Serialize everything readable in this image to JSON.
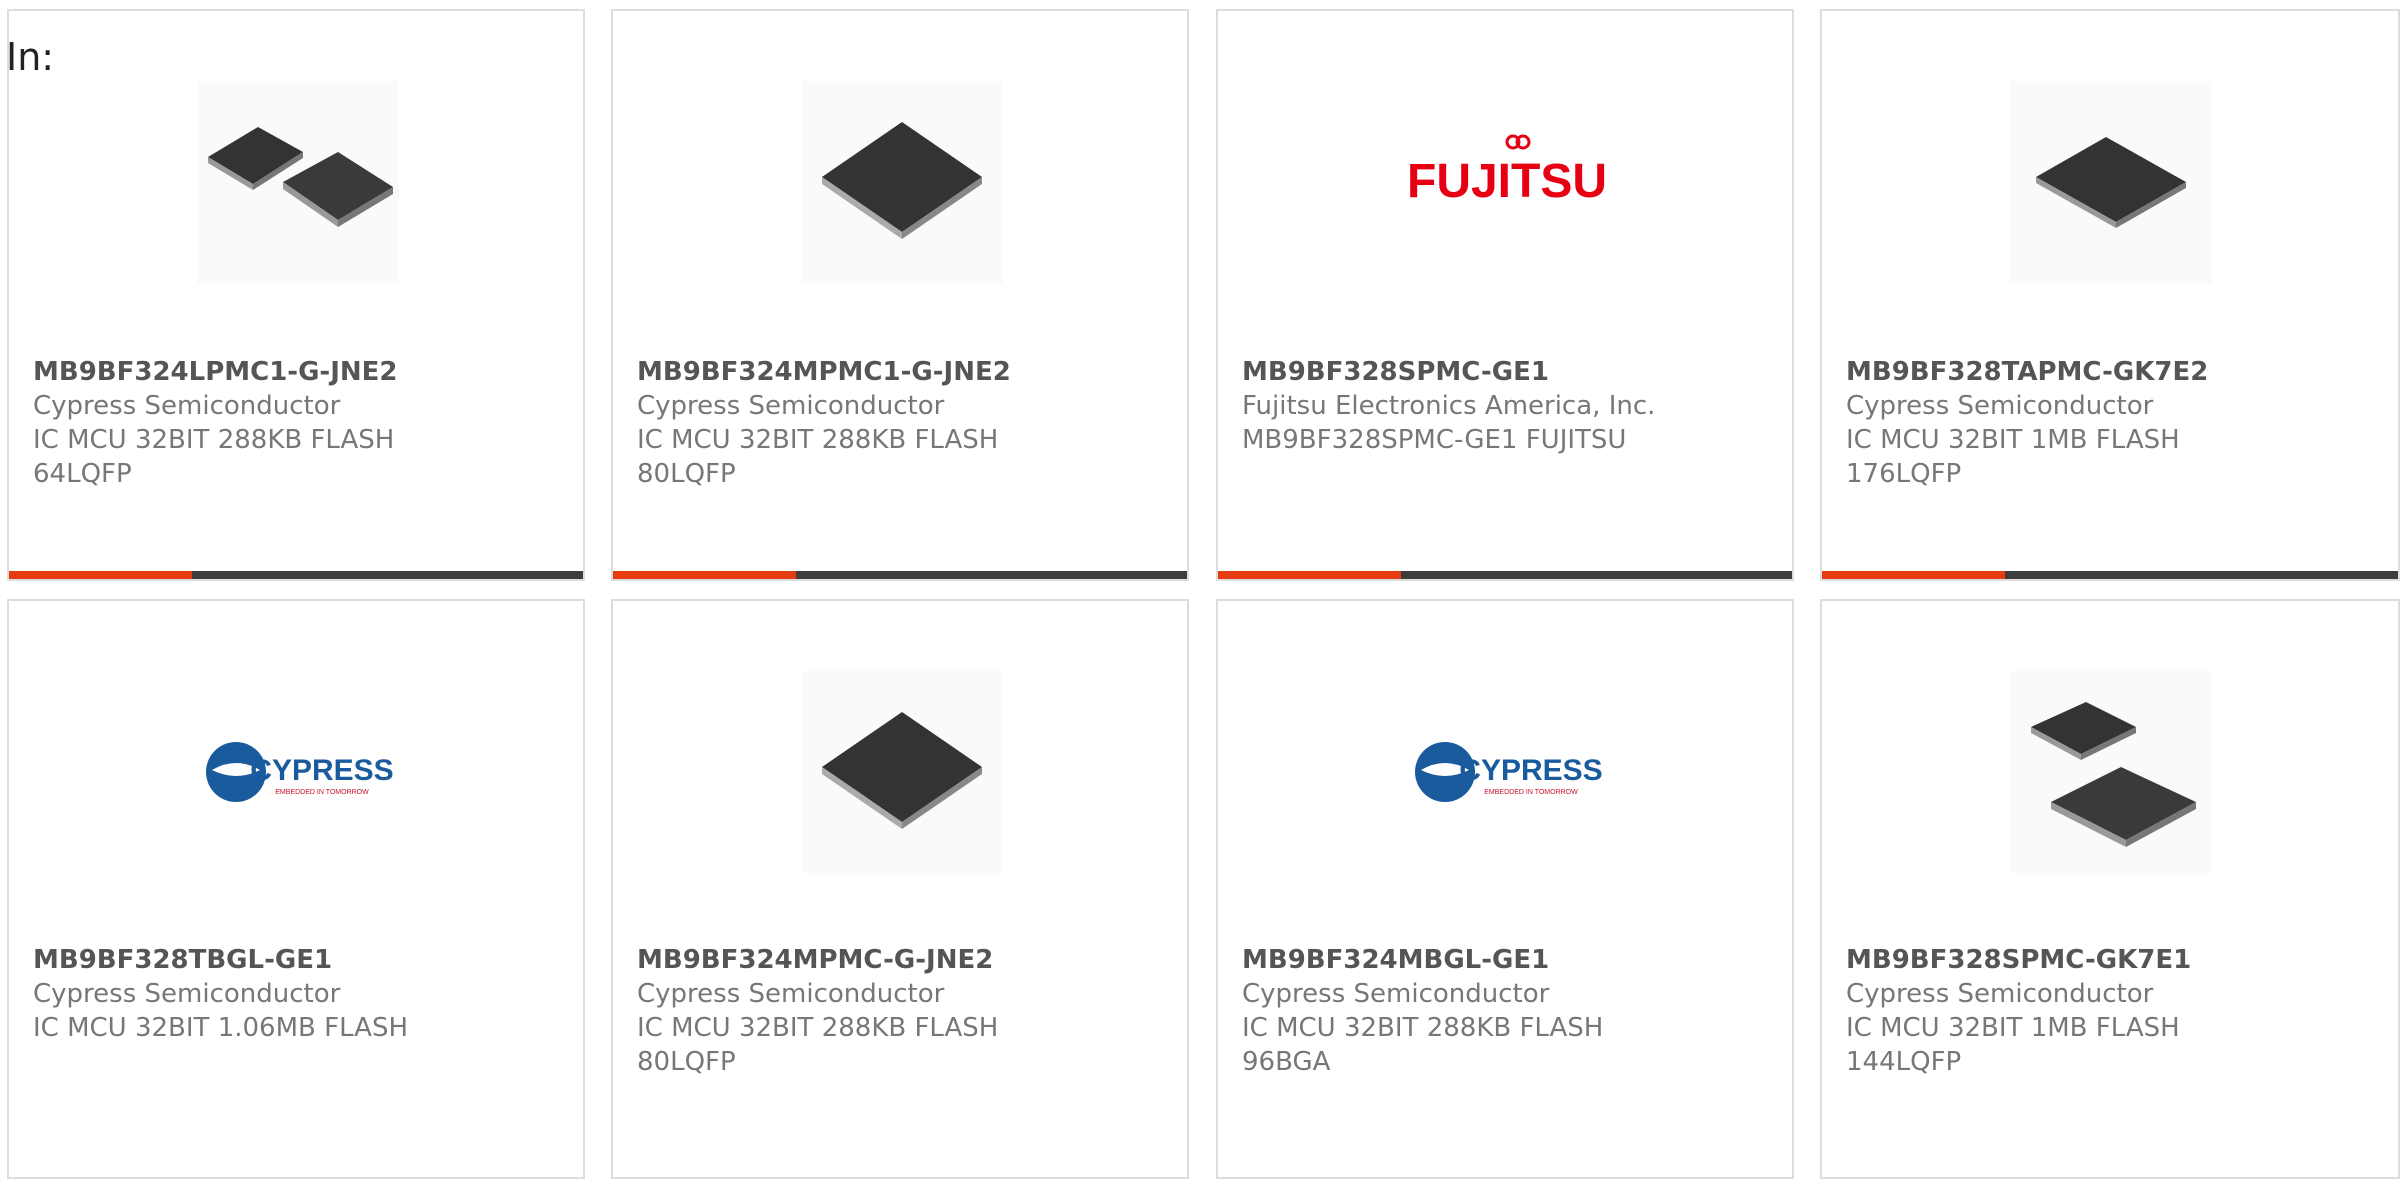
{
  "header": {
    "in_label": "In:"
  },
  "accent_color": "#e53c12",
  "bar_color": "#3d3d3d",
  "products": [
    {
      "part_number": "MB9BF324LPMC1-G-JNE2",
      "manufacturer": "Cypress Semiconductor",
      "desc_line1": "IC MCU 32BIT 288KB FLASH",
      "desc_line2": "64LQFP",
      "image": "two-qfp-chips"
    },
    {
      "part_number": "MB9BF324MPMC1-G-JNE2",
      "manufacturer": "Cypress Semiconductor",
      "desc_line1": "IC MCU 32BIT 288KB FLASH",
      "desc_line2": "80LQFP",
      "image": "qfp-chip"
    },
    {
      "part_number": "MB9BF328SPMC-GE1",
      "manufacturer": "Fujitsu Electronics America, Inc.",
      "desc_line1": "MB9BF328SPMC-GE1 FUJITSU",
      "desc_line2": "",
      "image": "fujitsu-logo",
      "logo_text": "FUJITSU"
    },
    {
      "part_number": "MB9BF328TAPMC-GK7E2",
      "manufacturer": "Cypress Semiconductor",
      "desc_line1": "IC MCU 32BIT 1MB FLASH",
      "desc_line2": "176LQFP",
      "image": "qfp-chip-large"
    },
    {
      "part_number": "MB9BF328TBGL-GE1",
      "manufacturer": "Cypress Semiconductor",
      "desc_line1": "IC MCU 32BIT 1.06MB FLASH",
      "desc_line2": "",
      "image": "cypress-logo",
      "logo_text": "CYPRESS",
      "logo_tagline": "EMBEDDED IN TOMORROW"
    },
    {
      "part_number": "MB9BF324MPMC-G-JNE2",
      "manufacturer": "Cypress Semiconductor",
      "desc_line1": "IC MCU 32BIT 288KB FLASH",
      "desc_line2": "80LQFP",
      "image": "qfp-chip"
    },
    {
      "part_number": "MB9BF324MBGL-GE1",
      "manufacturer": "Cypress Semiconductor",
      "desc_line1": "IC MCU 32BIT 288KB FLASH",
      "desc_line2": "96BGA",
      "image": "cypress-logo",
      "logo_text": "CYPRESS",
      "logo_tagline": "EMBEDDED IN TOMORROW"
    },
    {
      "part_number": "MB9BF328SPMC-GK7E1",
      "manufacturer": "Cypress Semiconductor",
      "desc_line1": "IC MCU 32BIT 1MB FLASH",
      "desc_line2": "144LQFP",
      "image": "two-qfp-chips-offset"
    }
  ]
}
